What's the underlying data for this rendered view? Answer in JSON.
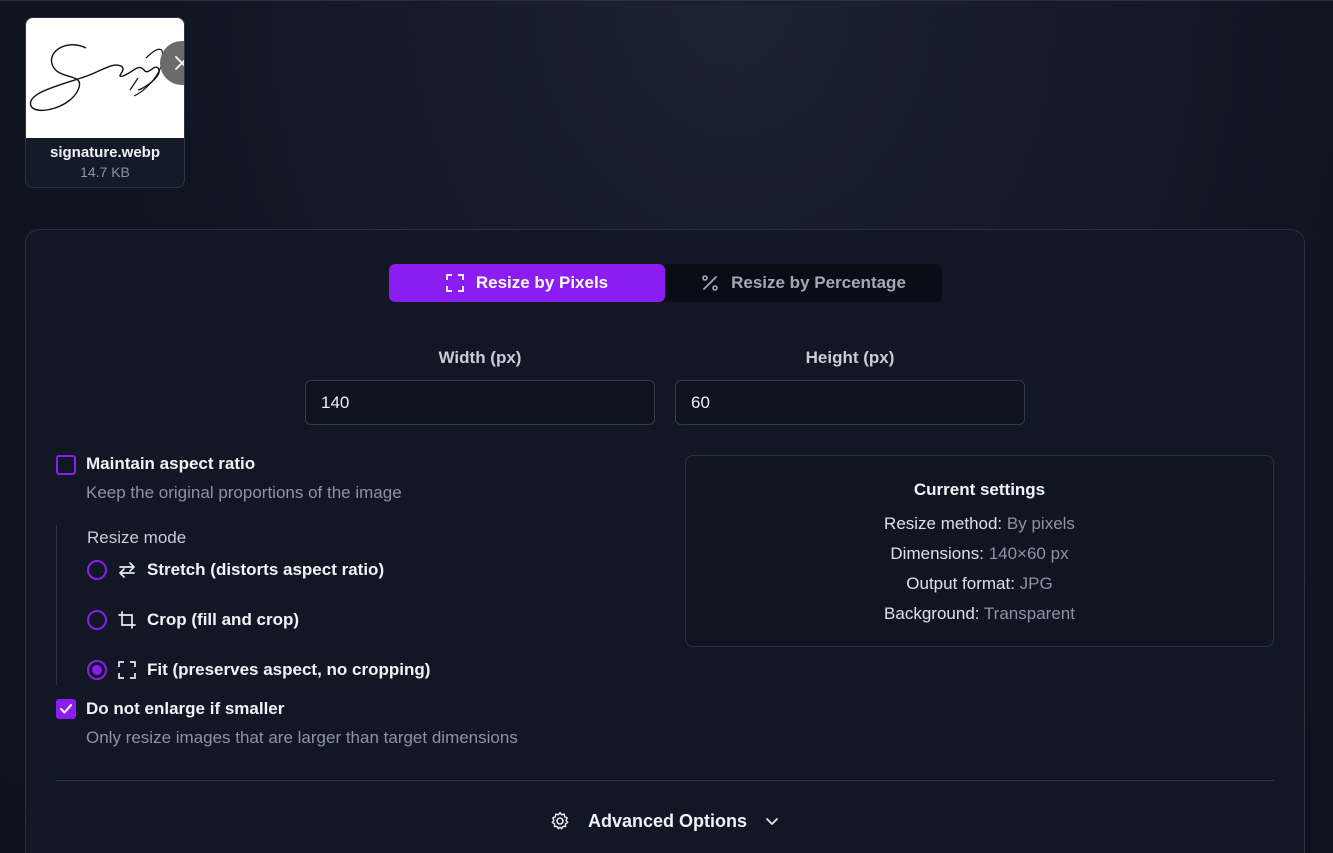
{
  "file": {
    "name": "signature.webp",
    "size": "14.7 KB"
  },
  "tabs": [
    {
      "label": "Resize by Pixels",
      "icon": "expand-corners-icon",
      "active": true
    },
    {
      "label": "Resize by Percentage",
      "icon": "percent-icon",
      "active": false
    }
  ],
  "dimensions": {
    "width_label": "Width (px)",
    "width_value": "140",
    "height_label": "Height (px)",
    "height_value": "60"
  },
  "aspect": {
    "title": "Maintain aspect ratio",
    "desc": "Keep the original proportions of the image",
    "checked": false
  },
  "resize_mode": {
    "label": "Resize mode",
    "options": [
      {
        "label": "Stretch (distorts aspect ratio)",
        "icon": "swap-arrows-icon",
        "selected": false
      },
      {
        "label": "Crop (fill and crop)",
        "icon": "crop-icon",
        "selected": false
      },
      {
        "label": "Fit (preserves aspect, no cropping)",
        "icon": "fit-corners-icon",
        "selected": true
      }
    ]
  },
  "no_enlarge": {
    "title": "Do not enlarge if smaller",
    "desc": "Only resize images that are larger than target dimensions",
    "checked": true
  },
  "current_settings": {
    "title": "Current settings",
    "rows": [
      {
        "key": "Resize method:",
        "value": "By pixels"
      },
      {
        "key": "Dimensions:",
        "value": "140×60 px"
      },
      {
        "key": "Output format:",
        "value": "JPG"
      },
      {
        "key": "Background:",
        "value": "Transparent"
      }
    ]
  },
  "advanced": {
    "label": "Advanced Options"
  },
  "colors": {
    "accent": "#8b1cf2",
    "background": "#101522",
    "muted_text": "#8d93a3"
  }
}
